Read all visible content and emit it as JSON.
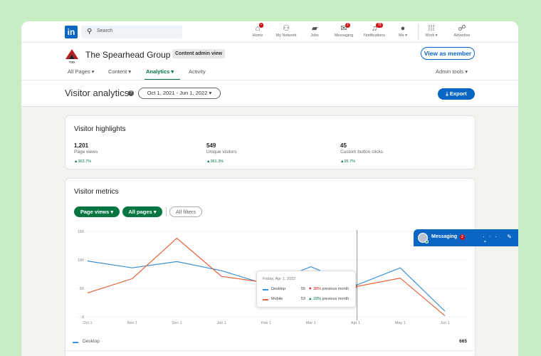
{
  "nav": {
    "logo": "in",
    "search_placeholder": "Search",
    "items": [
      {
        "label": "Home",
        "icon": "home-icon",
        "badge": ""
      },
      {
        "label": "My Network",
        "icon": "network-icon",
        "badge": ""
      },
      {
        "label": "Jobs",
        "icon": "briefcase-icon",
        "badge": ""
      },
      {
        "label": "Messaging",
        "icon": "chat-icon",
        "badge": "2"
      },
      {
        "label": "Notifications",
        "icon": "bell-icon",
        "badge": "78"
      },
      {
        "label": "Me ▾",
        "icon": "avatar",
        "badge": ""
      },
      {
        "label": "Work ▾",
        "icon": "grid-icon",
        "badge": ""
      },
      {
        "label": "Advertise",
        "icon": "advertise-icon",
        "badge": ""
      }
    ]
  },
  "org": {
    "name": "The Spearhead Group Inc.",
    "admin_tag": "Content admin view",
    "view_member": "View as member"
  },
  "tabs": [
    {
      "label": "All Pages ▾",
      "active": false
    },
    {
      "label": "Content ▾",
      "active": false
    },
    {
      "label": "Analytics ▾",
      "active": true
    },
    {
      "label": "Activity",
      "active": false
    }
  ],
  "admin_tools": "Admin tools ▾",
  "page": {
    "title": "Visitor analytics",
    "date_range": "Oct 1, 2021 - Jun 1, 2022 ▾",
    "export": "⤓ Export"
  },
  "highlights": {
    "title": "Visitor highlights",
    "items": [
      {
        "value": "1,201",
        "label": "Page views",
        "change": "▲363.7%"
      },
      {
        "value": "549",
        "label": "Unique visitors",
        "change": "▲361.3%"
      },
      {
        "value": "45",
        "label": "Custom button clicks",
        "change": "▲95.7%"
      }
    ]
  },
  "metrics": {
    "title": "Visitor metrics",
    "filters": [
      "Page views ▾",
      "All pages ▾",
      "All filters"
    ]
  },
  "chart_data": {
    "type": "line",
    "x": [
      "Oct 1",
      "Nov 1",
      "Dec 1",
      "Jan 1",
      "Feb 1",
      "Mar 1",
      "Apr 1",
      "May 1",
      "Jun 1"
    ],
    "yticks": [
      0,
      50,
      100,
      150
    ],
    "ylim": [
      0,
      150
    ],
    "series": [
      {
        "name": "Desktop",
        "color": "#3b8fd6",
        "values": [
          98,
          86,
          97,
          81,
          57,
          88,
          55,
          86,
          10
        ]
      },
      {
        "name": "Mobile",
        "color": "#e2623e",
        "values": [
          42,
          67,
          138,
          71,
          60,
          47,
          53,
          68,
          2
        ]
      }
    ]
  },
  "tooltip": {
    "date": "Friday, Apr 1, 2022",
    "rows": [
      {
        "name": "Desktop",
        "value": "55",
        "change": "▼ 38%",
        "change_color": "#cc1016",
        "suffix": "previous month"
      },
      {
        "name": "Mobile",
        "value": "53",
        "change": "▲ 18%",
        "change_color": "#057642",
        "suffix": "previous month"
      }
    ]
  },
  "legend_total": {
    "name": "Desktop",
    "value": "665"
  },
  "messaging": {
    "label": "Messaging",
    "badge": "2",
    "icons": "··· ✎ ⌃"
  }
}
